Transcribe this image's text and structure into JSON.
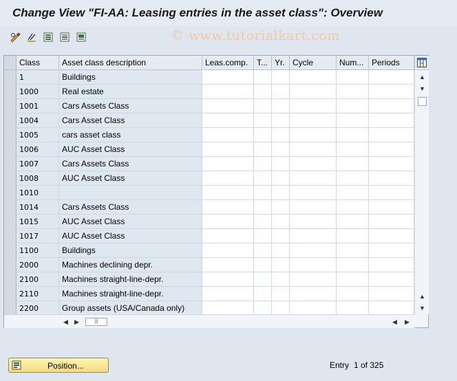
{
  "window": {
    "title": "Change View \"FI-AA: Leasing entries in the asset class\": Overview",
    "watermark": "© www.tutorialkart.com"
  },
  "toolbar": {
    "icons": [
      "edit-glasses-icon",
      "undo-icon",
      "select-all-icon",
      "deselect-icon",
      "select-block-icon"
    ]
  },
  "table": {
    "columns": [
      "Class",
      "Asset class description",
      "Leas.comp.",
      "T...",
      "Yr.",
      "Cycle",
      "Num...",
      "Periods"
    ],
    "rows": [
      {
        "class": "1",
        "description": "Buildings"
      },
      {
        "class": "1000",
        "description": "Real estate"
      },
      {
        "class": "1001",
        "description": "Cars Assets Class"
      },
      {
        "class": "1004",
        "description": "Cars Asset Class"
      },
      {
        "class": "1005",
        "description": "cars asset class"
      },
      {
        "class": "1006",
        "description": "AUC Asset Class"
      },
      {
        "class": "1007",
        "description": "Cars Assets Class"
      },
      {
        "class": "1008",
        "description": "AUC Asset Class"
      },
      {
        "class": "1010",
        "description": ""
      },
      {
        "class": "1014",
        "description": "Cars Assets Class"
      },
      {
        "class": "1015",
        "description": "AUC Asset Class"
      },
      {
        "class": "1017",
        "description": "AUC Asset Class"
      },
      {
        "class": "1100",
        "description": "Buildings"
      },
      {
        "class": "2000",
        "description": "Machines declining depr."
      },
      {
        "class": "2100",
        "description": "Machines straight-line-depr."
      },
      {
        "class": "2110",
        "description": "Machines straight-line-depr."
      },
      {
        "class": "2200",
        "description": "Group assets (USA/Canada only)"
      }
    ]
  },
  "footer": {
    "position_button": "Position...",
    "entry_label": "Entry",
    "entry_value": "1 of 325"
  }
}
